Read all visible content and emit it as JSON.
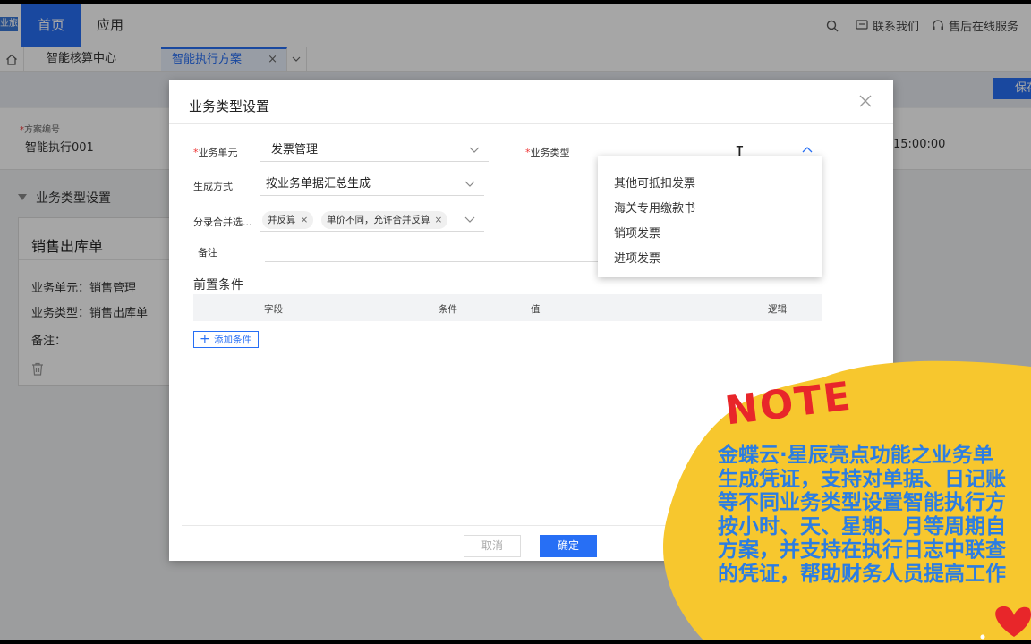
{
  "topnav": {
    "logo_text": "业旅",
    "home_label": "首页",
    "app_label": "应用",
    "contact_label": "联系我们",
    "service_label": "售后在线服务"
  },
  "tabs": {
    "items": [
      {
        "label": "智能核算中心"
      },
      {
        "label": "智能执行方案",
        "close": "×"
      }
    ]
  },
  "page": {
    "save_label": "保存",
    "plan_code_label": "方案编号",
    "plan_code_value": "智能执行001",
    "date_value": "15:00:00",
    "section_title": "业务类型设置",
    "card": {
      "title": "销售出库单",
      "unit_line": "业务单元：销售管理",
      "type_line": "业务类型：销售出库单",
      "remark_line": "备注："
    }
  },
  "modal": {
    "title": "业务类型设置",
    "fields": {
      "unit_label": "业务单元",
      "unit_value": "发票管理",
      "type_label": "业务类型",
      "type_value": "",
      "gen_label": "生成方式",
      "gen_value": "按业务单据汇总生成",
      "merge_label": "分录合并选...",
      "merge_tags": [
        "并反算",
        "单价不同，允许合并反算"
      ],
      "merge_tag_close": "×",
      "remark_label": "备注"
    },
    "dropdown_options": [
      "其他可抵扣发票",
      "海关专用缴款书",
      "销项发票",
      "进项发票"
    ],
    "precondition": {
      "title": "前置条件",
      "columns": [
        "字段",
        "条件",
        "值",
        "逻辑"
      ],
      "add_label": "添加条件",
      "add_icon": "+"
    },
    "cancel_label": "取消",
    "ok_label": "确定"
  },
  "note": {
    "heading": "NOTE",
    "lines": [
      "金蝶云·星辰亮点功能之业务单",
      "生成凭证，支持对单据、日记账",
      "等不同业务类型设置智能执行方",
      "按小时、天、星期、月等周期自",
      "方案，并支持在执行日志中联查",
      "的凭证，帮助财务人员提高工作"
    ],
    "colors": {
      "blob": "#f7c72e",
      "text": "#2c7de2",
      "heading": "#e8262a",
      "heart": "#e8262a"
    }
  },
  "colors": {
    "primary": "#276ff5"
  }
}
